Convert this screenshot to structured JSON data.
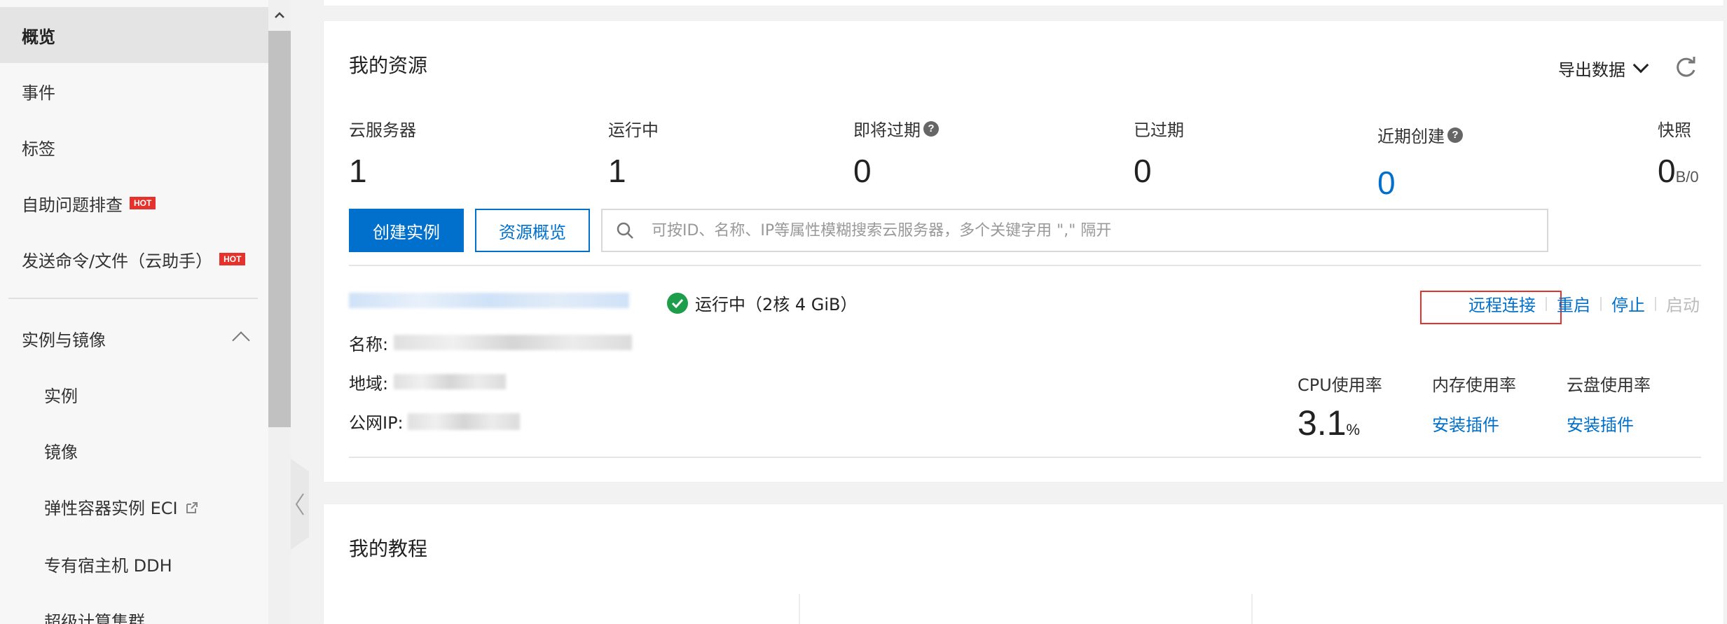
{
  "sidebar": {
    "items": [
      {
        "label": "概览",
        "active": true
      },
      {
        "label": "事件"
      },
      {
        "label": "标签"
      },
      {
        "label": "自助问题排查",
        "badge": "HOT"
      },
      {
        "label": "发送命令/文件（云助手）",
        "badge": "HOT"
      }
    ],
    "group": {
      "label": "实例与镜像",
      "expanded": true
    },
    "sub_items": [
      {
        "label": "实例"
      },
      {
        "label": "镜像"
      },
      {
        "label": "弹性容器实例 ECI",
        "icon": "external-link-icon"
      },
      {
        "label": "专有宿主机 DDH"
      },
      {
        "label": "超级计算集群"
      }
    ]
  },
  "resources": {
    "title": "我的资源",
    "export_label": "导出数据",
    "stats": [
      {
        "label": "云服务器",
        "value": "1"
      },
      {
        "label": "运行中",
        "value": "1"
      },
      {
        "label": "即将过期",
        "value": "0",
        "help": "?"
      },
      {
        "label": "已过期",
        "value": "0"
      },
      {
        "label": "近期创建",
        "value": "0",
        "help": "?"
      },
      {
        "label": "快照",
        "value": "0",
        "unit": "B/0"
      }
    ],
    "create_button": "创建实例",
    "overview_button": "资源概览",
    "search_placeholder": "可按ID、名称、IP等属性模糊搜索云服务器，多个关键字用 \",\" 隔开",
    "instance": {
      "status": "运行中（2核 4 GiB）",
      "actions": {
        "remote": "远程连接",
        "restart": "重启",
        "stop": "停止",
        "start": "启动"
      },
      "name_label": "名称:",
      "region_label": "地域:",
      "ip_label": "公网IP:",
      "metrics": [
        {
          "label": "CPU使用率",
          "value": "3.1",
          "unit": "%"
        },
        {
          "label": "内存使用率",
          "link": "安装插件"
        },
        {
          "label": "云盘使用率",
          "link": "安装插件"
        }
      ]
    }
  },
  "tutorials": {
    "title": "我的教程"
  },
  "colors": {
    "primary": "#0070cc",
    "hot": "#e5322d",
    "success": "#1e9e4a"
  }
}
